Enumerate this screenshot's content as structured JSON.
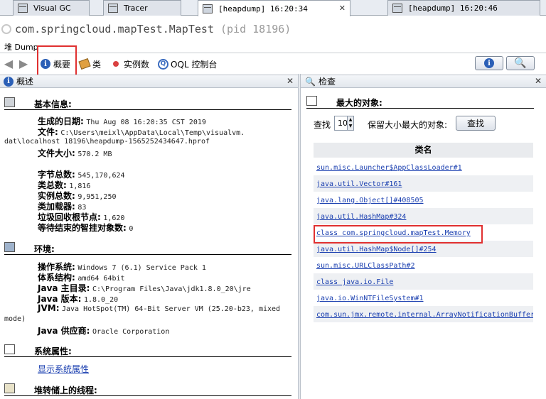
{
  "tabs": [
    {
      "label": "Visual GC"
    },
    {
      "label": "Tracer"
    },
    {
      "label": "[heapdump] 16:20:34"
    },
    {
      "label": "[heapdump] 16:20:46"
    }
  ],
  "title": {
    "app": "com.springcloud.mapTest.MapTest",
    "pid": "(pid 18196)"
  },
  "subhead": "堆 Dump",
  "toolbar": {
    "summary_label": "概要",
    "classes_label": "类",
    "instances_label": "实例数",
    "oql_label": "OQL 控制台"
  },
  "left_panel": {
    "header": "概述",
    "basic_info": {
      "title": "基本信息:",
      "date_label": "生成的日期:",
      "date_value": "Thu Aug 08 16:20:35 CST 2019",
      "file_label": "文件:",
      "file_value_1": "C:\\Users\\meixl\\AppData\\Local\\Temp\\visualvm.",
      "file_value_2": "dat\\localhost 18196\\heapdump-1565252434647.hprof",
      "size_label": "文件大小:",
      "size_value": "570.2 MB",
      "bytes_label": "字节总数:",
      "bytes_value": "545,170,624",
      "classes_label": "类总数:",
      "classes_value": "1,816",
      "instances_label": "实例总数:",
      "instances_value": "9,951,250",
      "loaders_label": "类加载器:",
      "loaders_value": "83",
      "gcroots_label": "垃圾回收根节点:",
      "gcroots_value": "1,620",
      "finalize_label": "等待结束的智挂对象数:",
      "finalize_value": "0"
    },
    "environment": {
      "title": "环境:",
      "os_label": "操作系统:",
      "os_value": "Windows 7 (6.1) Service Pack 1",
      "arch_label": "体系结构:",
      "arch_value": "amd64 64bit",
      "home_label": "Java 主目录:",
      "home_value": "C:\\Program Files\\Java\\jdk1.8.0_20\\jre",
      "version_label": "Java 版本:",
      "version_value": "1.8.0_20",
      "jvm_label": "JVM:",
      "jvm_value_1": "Java HotSpot(TM) 64-Bit Server VM (25.20-b23, mixed",
      "jvm_value_2": "mode)",
      "vendor_label": "Java 供应商:",
      "vendor_value": "Oracle Corporation"
    },
    "system_props": {
      "title": "系统属性:",
      "link": "显示系统属性"
    },
    "threads": {
      "title": "堆转储上的线程:"
    }
  },
  "right_panel": {
    "header": "检查",
    "largest_title": "最大的对象:",
    "find_label": "查找",
    "count_value": "10",
    "count_suffix": "保留大小最大的对象:",
    "find_button": "查找",
    "column_header": "类名",
    "classes": [
      "sun.misc.Launcher$AppClassLoader#1",
      "java.util.Vector#161",
      "java.lang.Object[]#408505",
      "java.util.HashMap#324",
      "class com.springcloud.mapTest.Memory",
      "java.util.HashMap$Node[]#254",
      "sun.misc.URLClassPath#2",
      "class java.io.File",
      "java.io.WinNTFileSystem#1",
      "com.sun.jmx.remote.internal.ArrayNotificationBuffer"
    ]
  },
  "colors": {
    "highlight": "#e03030",
    "link": "#1a3fb0",
    "accent": "#2b5fb6"
  }
}
